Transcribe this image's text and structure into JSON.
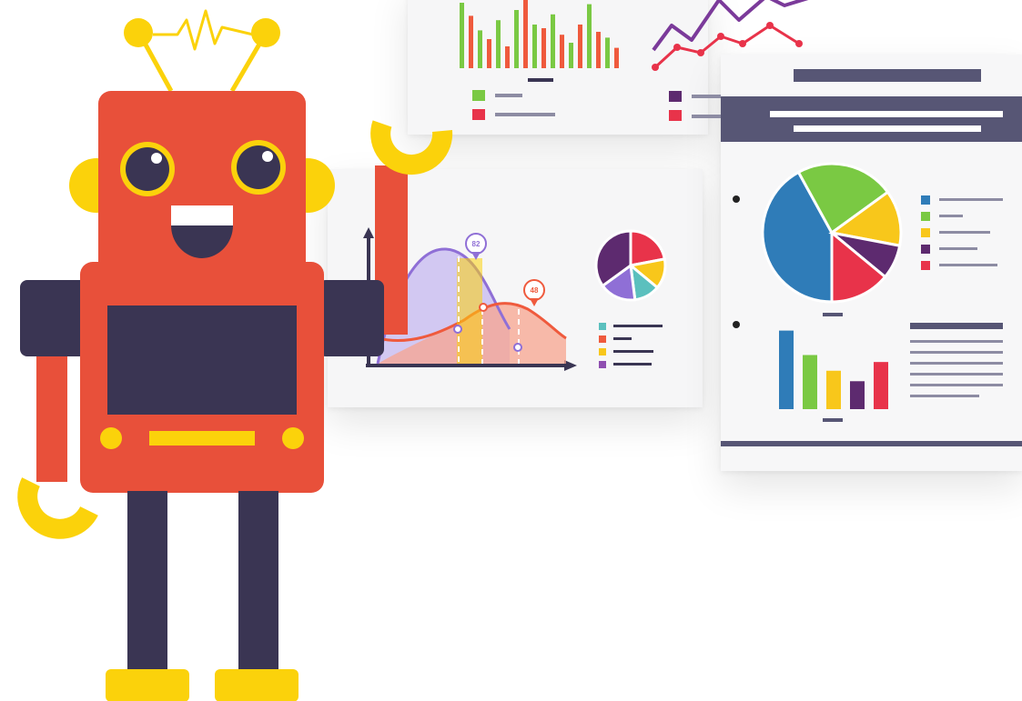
{
  "colors": {
    "robot_red": "#e8503a",
    "robot_navy": "#3a3553",
    "robot_yellow": "#fbd20b",
    "panel_bg": "#f6f6f7",
    "header_navy": "#575675",
    "blue": "#2f7cb8",
    "green": "#7ac943",
    "yellow": "#f8c71b",
    "purple": "#5d2a6f",
    "crimson": "#e8334a",
    "orange": "#ef5a3d",
    "lavender": "#8f6fd6",
    "teal": "#5bc0be"
  },
  "icons": {
    "robot": "robot-illustration",
    "antenna": "antenna-icon",
    "pie": "pie-chart-icon",
    "legend": "legend-icon"
  },
  "badges": {
    "peak_one": "82",
    "peak_two": "48"
  },
  "pie_slices": [
    {
      "name": "blue",
      "fraction": 0.42
    },
    {
      "name": "green",
      "fraction": 0.23
    },
    {
      "name": "yellow",
      "fraction": 0.13
    },
    {
      "name": "purple",
      "fraction": 0.08
    },
    {
      "name": "crimson",
      "fraction": 0.14
    }
  ],
  "small_pie_slices": [
    {
      "name": "crimson",
      "fraction": 0.22
    },
    {
      "name": "yellow",
      "fraction": 0.14
    },
    {
      "name": "teal",
      "fraction": 0.12
    },
    {
      "name": "lavender",
      "fraction": 0.17
    },
    {
      "name": "purple",
      "fraction": 0.35
    }
  ],
  "doc_bars": [
    {
      "name": "blue",
      "value": 0.9
    },
    {
      "name": "green",
      "value": 0.62
    },
    {
      "name": "yellow",
      "value": 0.44
    },
    {
      "name": "purple",
      "value": 0.32
    },
    {
      "name": "crimson",
      "value": 0.54
    }
  ],
  "top_bars": [
    {
      "name": "green",
      "value": 0.9
    },
    {
      "name": "orange",
      "value": 0.72
    },
    {
      "name": "green",
      "value": 0.52
    },
    {
      "name": "orange",
      "value": 0.4
    },
    {
      "name": "green",
      "value": 0.66
    },
    {
      "name": "orange",
      "value": 0.3
    },
    {
      "name": "green",
      "value": 0.8
    },
    {
      "name": "orange",
      "value": 0.98
    },
    {
      "name": "green",
      "value": 0.6
    },
    {
      "name": "orange",
      "value": 0.55
    },
    {
      "name": "green",
      "value": 0.74
    },
    {
      "name": "orange",
      "value": 0.46
    },
    {
      "name": "green",
      "value": 0.35
    },
    {
      "name": "orange",
      "value": 0.6
    },
    {
      "name": "green",
      "value": 0.88
    },
    {
      "name": "orange",
      "value": 0.5
    },
    {
      "name": "green",
      "value": 0.42
    },
    {
      "name": "orange",
      "value": 0.28
    }
  ]
}
